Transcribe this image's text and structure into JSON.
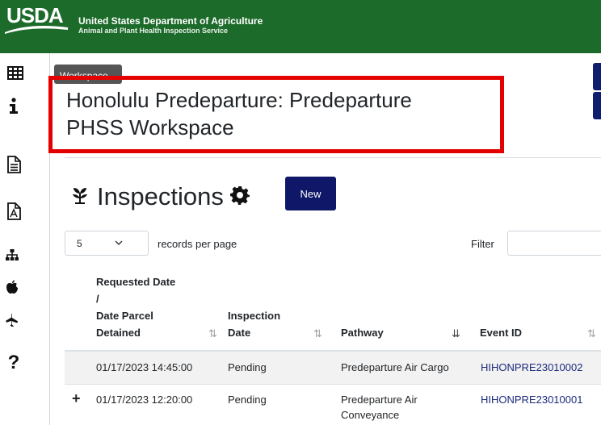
{
  "header": {
    "logo_text": "USDA",
    "agency_line1": "United States Department of Agriculture",
    "agency_line2": "Animal and Plant Health Inspection Service",
    "color": "#1d6b2b"
  },
  "sidebar": {
    "icons": [
      "grid-icon",
      "info-icon",
      "document-icon",
      "pdf-icon",
      "sitemap-icon",
      "apple-icon",
      "airplane-icon",
      "help-icon"
    ]
  },
  "workspace": {
    "badge": "Workspace",
    "title_line1": "Honolulu Predeparture: Predeparture",
    "title_line2": "PHSS Workspace"
  },
  "inspections": {
    "title": "Inspections",
    "new_button": "New",
    "new_button_color": "#0f1769",
    "records_per_page_value": "5",
    "records_per_page_label": "records per page",
    "filter_label": "Filter",
    "filter_value": ""
  },
  "table": {
    "columns": [
      {
        "l1": "Requested Date",
        "l2": "/",
        "l3": "Date Parcel",
        "l4": "Detained"
      },
      {
        "l1": "Inspection",
        "l2": "Date"
      },
      {
        "l1": "Pathway"
      },
      {
        "l1": "Event ID"
      }
    ],
    "rows": [
      {
        "date": "01/17/2023 14:45:00",
        "inspection": "Pending",
        "pathway1": "Predeparture Air Cargo",
        "pathway2": "",
        "event": "HIHONPRE23010002",
        "expand": ""
      },
      {
        "date": "01/17/2023 12:20:00",
        "inspection": "Pending",
        "pathway1": "Predeparture Air",
        "pathway2": "Conveyance",
        "event": "HIHONPRE23010001",
        "expand": "+"
      }
    ]
  }
}
